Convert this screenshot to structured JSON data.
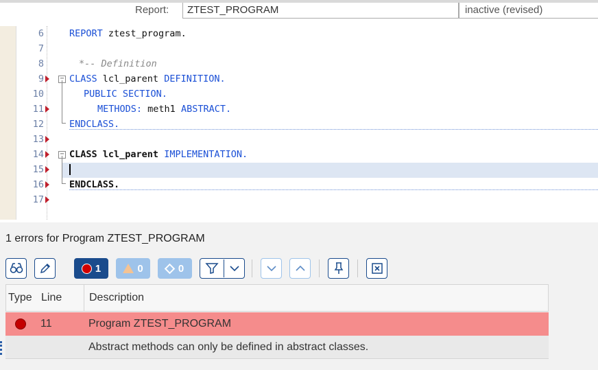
{
  "header": {
    "report_label": "Report:",
    "report_value": "ZTEST_PROGRAM",
    "status": "inactive (revised)"
  },
  "editor": {
    "lines": [
      {
        "no": "6",
        "text": "REPORT ztest_program."
      },
      {
        "no": "7",
        "text": ""
      },
      {
        "no": "8",
        "text": "*-- Definition"
      },
      {
        "no": "9",
        "text": "CLASS lcl_parent DEFINITION."
      },
      {
        "no": "10",
        "text": "PUBLIC SECTION."
      },
      {
        "no": "11",
        "text": "METHODS: meth1 ABSTRACT."
      },
      {
        "no": "12",
        "text": "ENDCLASS."
      },
      {
        "no": "13",
        "text": ""
      },
      {
        "no": "14",
        "text": "CLASS lcl_parent IMPLEMENTATION."
      },
      {
        "no": "15",
        "text": ""
      },
      {
        "no": "16",
        "text": "ENDCLASS."
      },
      {
        "no": "17",
        "text": ""
      }
    ],
    "splitter": "...."
  },
  "panel": {
    "title": "1 errors for Program ZTEST_PROGRAM",
    "toolbar": {
      "find_icon": "binoculars-icon",
      "edit_icon": "pencil-icon",
      "errors_count": "1",
      "warnings_count": "0",
      "info_count": "0",
      "filter_icon": "filter-icon",
      "down_icon": "chevron-down-icon",
      "up_icon": "chevron-up-icon",
      "pin_icon": "pin-icon",
      "close_icon": "close-icon"
    },
    "columns": {
      "type": "Type",
      "line": "Line",
      "description": "Description"
    },
    "error": {
      "line": "11",
      "program": "Program ZTEST_PROGRAM",
      "message": "Abstract methods can only be defined in abstract classes."
    }
  },
  "colors": {
    "error_row": "#f58c8c",
    "keyword": "#1a4fd6",
    "error_marker": "#c0202d"
  }
}
